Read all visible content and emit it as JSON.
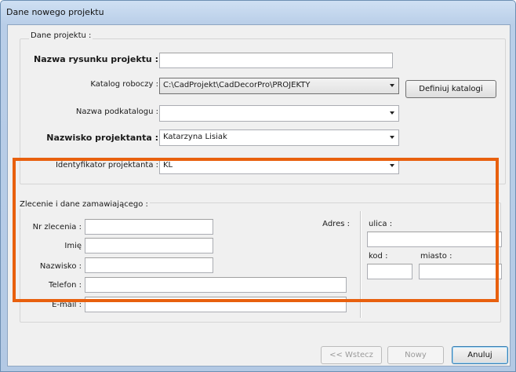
{
  "window": {
    "title": "Dane nowego projektu"
  },
  "project_group": {
    "legend": "Dane projektu :",
    "drawing_name": {
      "label": "Nazwa rysunku projektu :",
      "value": ""
    },
    "working_dir": {
      "label": "Katalog roboczy :",
      "value": "C:\\CadProjekt\\CadDecorPro\\PROJEKTY"
    },
    "define_dirs_button": "Definiuj katalogi",
    "subdir_name": {
      "label": "Nazwa podkatalogu :",
      "value": ""
    },
    "designer_name": {
      "label": "Nazwisko projektanta :",
      "value": "Katarzyna Lisiak"
    },
    "designer_id": {
      "label": "Identyfikator projektanta :",
      "value": "KL"
    }
  },
  "order_group": {
    "legend": "Zlecenie i dane zamawiającego :",
    "order_no": {
      "label": "Nr zlecenia :",
      "value": ""
    },
    "first_name": {
      "label": "Imię",
      "value": ""
    },
    "last_name": {
      "label": "Nazwisko :",
      "value": ""
    },
    "phone": {
      "label": "Telefon :",
      "value": ""
    },
    "email": {
      "label": "E-mail :",
      "value": ""
    },
    "address_label": "Adres :",
    "street": {
      "label": "ulica :",
      "value": ""
    },
    "postal_code": {
      "label": "kod :",
      "value": ""
    },
    "city": {
      "label": "miasto :",
      "value": ""
    }
  },
  "footer": {
    "back_button": "<< Wstecz",
    "new_button": "Nowy",
    "cancel_button": "Anuluj"
  },
  "colors": {
    "highlight_border": "#e8600e",
    "title_bar": "#cfe0f3"
  }
}
